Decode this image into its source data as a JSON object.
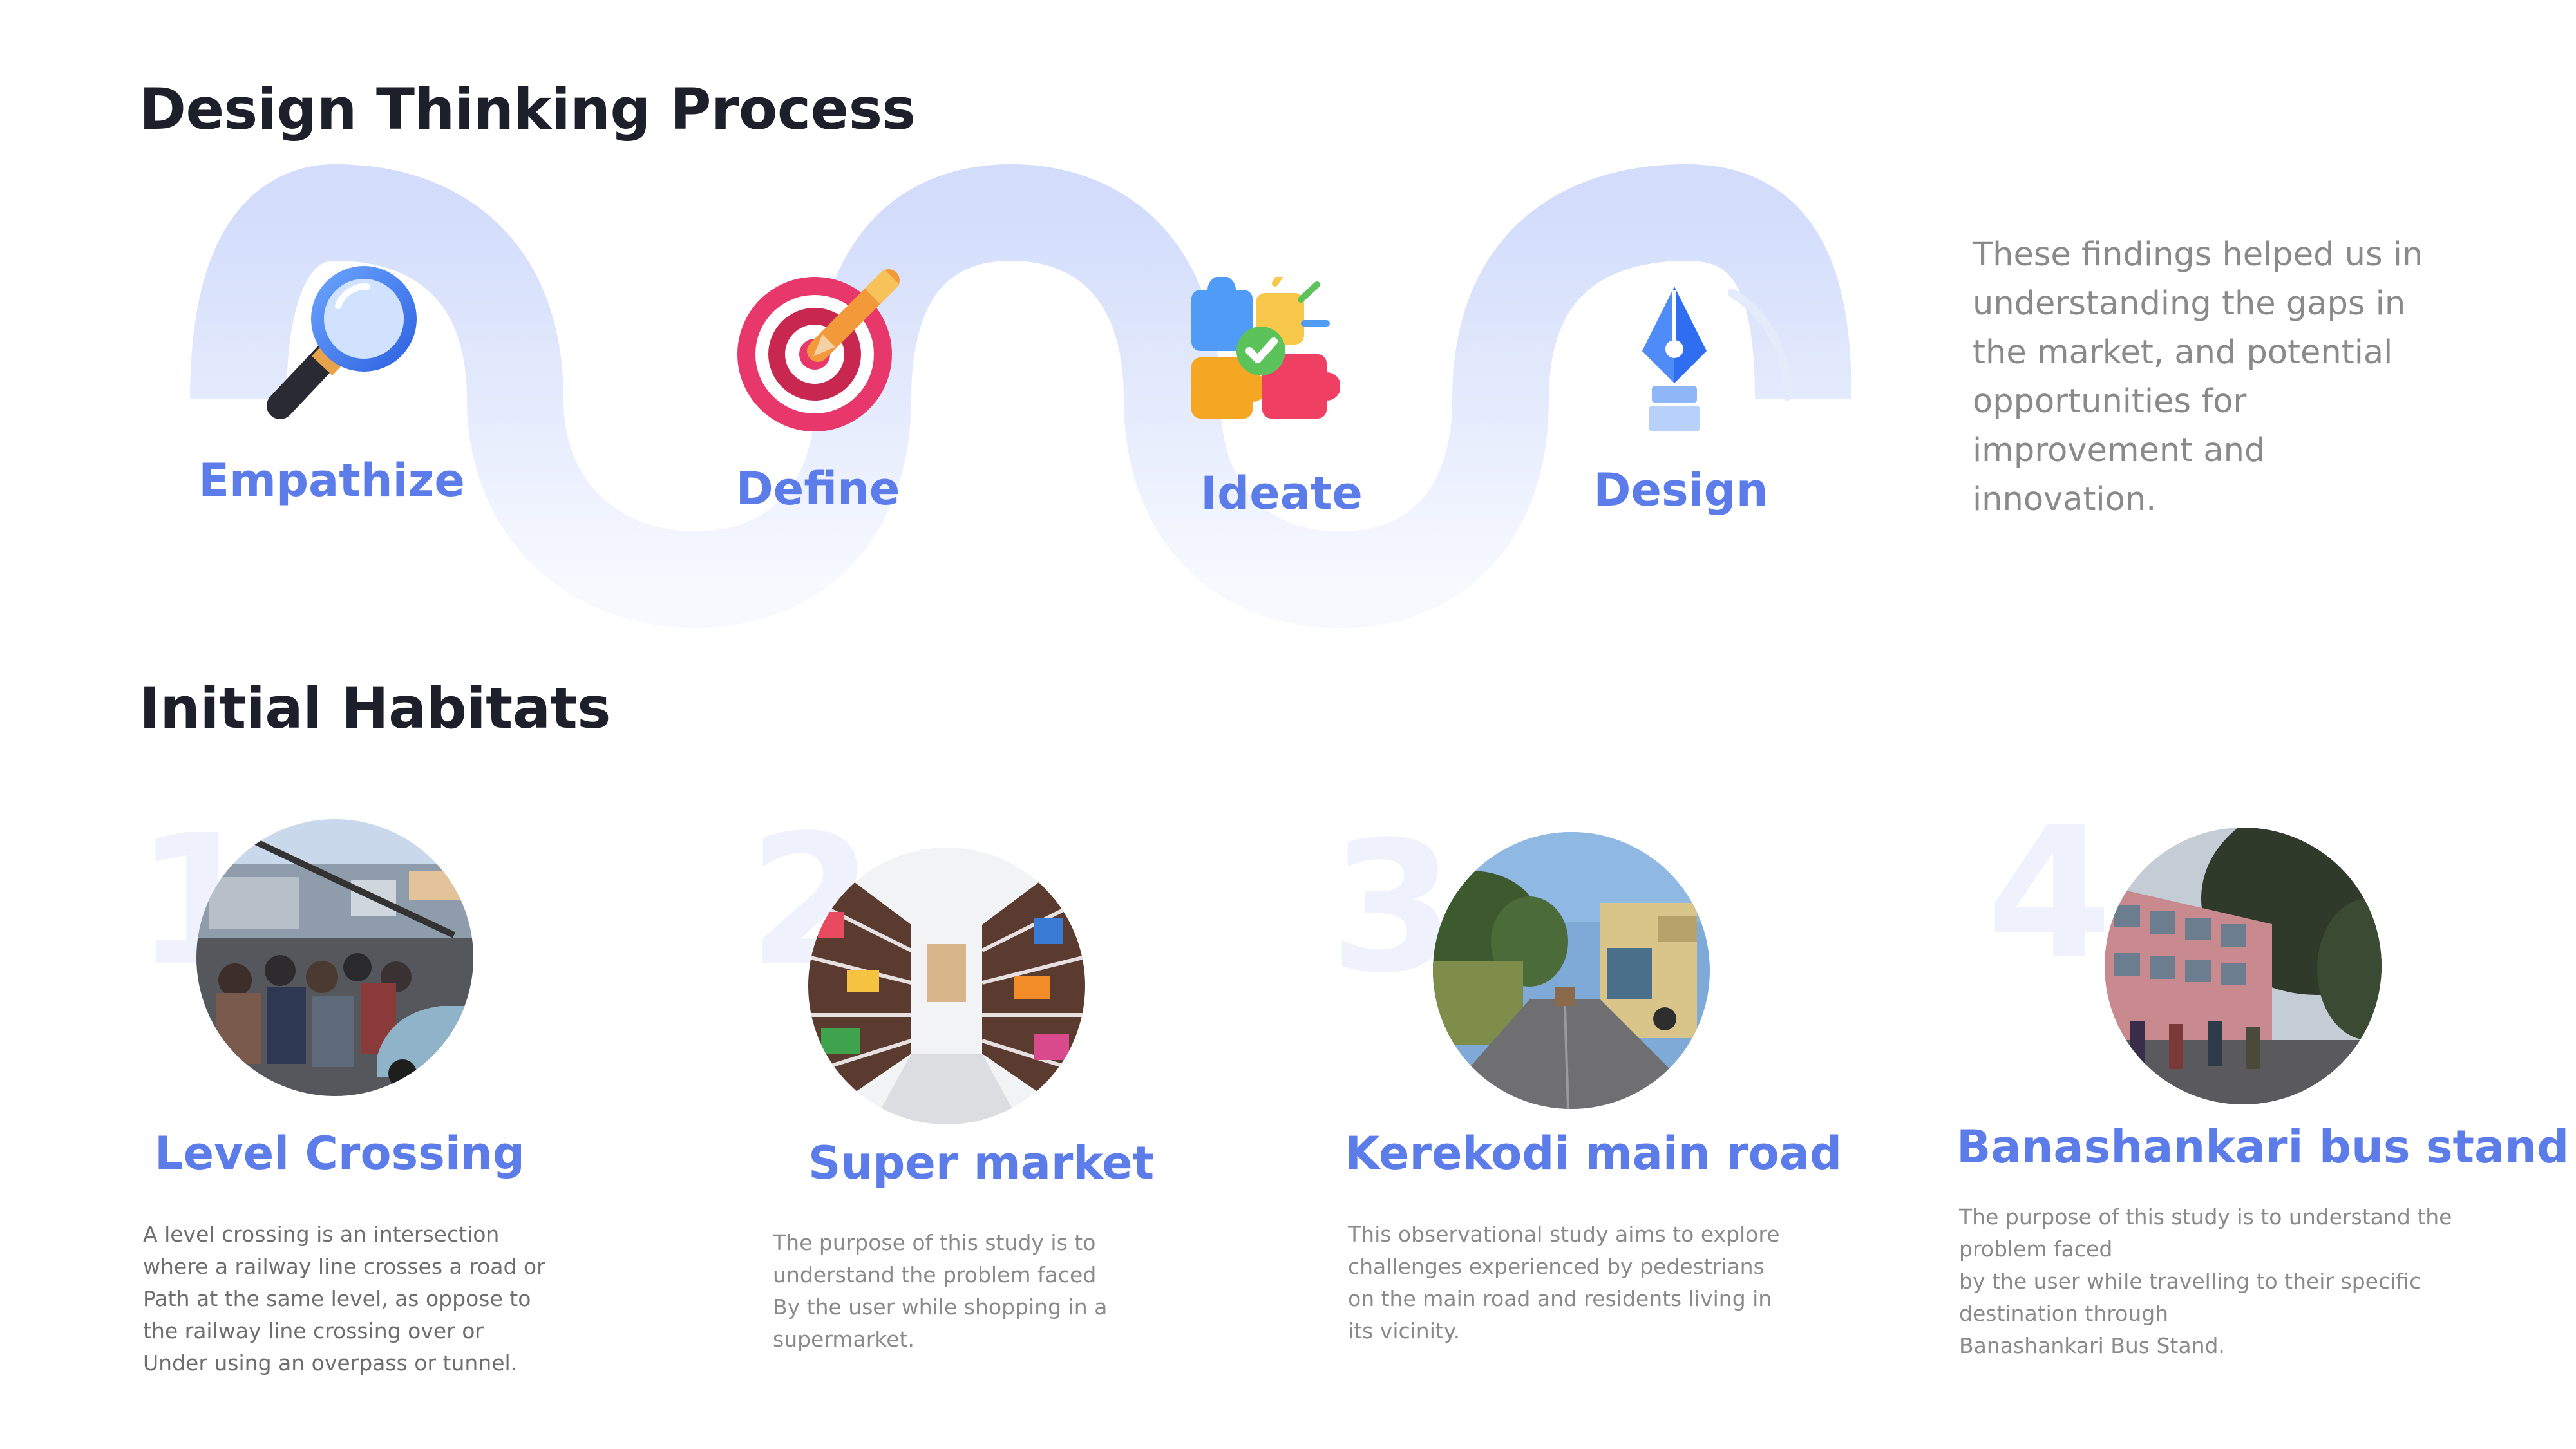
{
  "process": {
    "title": "Design Thinking Process",
    "steps": [
      {
        "label": "Empathize",
        "icon": "magnifier-icon"
      },
      {
        "label": "Define",
        "icon": "target-icon"
      },
      {
        "label": "Ideate",
        "icon": "puzzle-icon"
      },
      {
        "label": "Design",
        "icon": "pen-nib-icon"
      }
    ],
    "findings": "These findings helped us in understanding the gaps in the market, and potential opportunities for improvement and innovation.",
    "accent_color": "#5c7cea",
    "wave_color": "#d7e0fb"
  },
  "habitats": {
    "title": "Initial Habitats",
    "items": [
      {
        "number": "1",
        "title": "Level Crossing",
        "description": "A level crossing is an intersection\nwhere a railway line crosses a road or\nPath at the same level, as oppose to\nthe railway line crossing over or\nUnder using an overpass or tunnel.",
        "image": "level-crossing-photo"
      },
      {
        "number": "2",
        "title": "Super market",
        "description": "The purpose of this study is to\nunderstand the problem faced\nBy the user while shopping in a\nsupermarket.",
        "image": "supermarket-photo"
      },
      {
        "number": "3",
        "title": "Kerekodi main road",
        "description": "This observational study aims to explore\nchallenges experienced by pedestrians\non the main road and residents living in\nits vicinity.",
        "image": "main-road-photo"
      },
      {
        "number": "4",
        "title": "Banashankari bus stand",
        "description": "The purpose of this study is to understand the\nproblem faced\nby the user while travelling to their specific\ndestination through\nBanashankari Bus Stand.",
        "image": "bus-stand-photo"
      }
    ]
  }
}
